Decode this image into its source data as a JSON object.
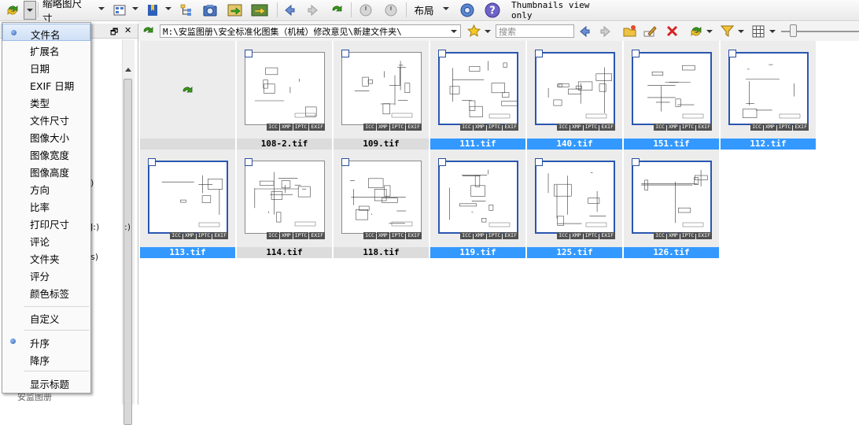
{
  "toolbar": {
    "thumbnail_size_label": "缩略图尺寸",
    "layout_label": "布局",
    "status_text": "Thumbnails view only"
  },
  "pathbar": {
    "path": "M:\\安监图册\\安全标准化图集（机械）修改意见\\新建文件夹\\",
    "search_placeholder": "搜索"
  },
  "sort_menu": {
    "items": [
      "文件名",
      "扩展名",
      "日期",
      "EXIF 日期",
      "类型",
      "文件尺寸",
      "图像大小",
      "图像宽度",
      "图像高度",
      "方向",
      "比率",
      "打印尺寸",
      "评论",
      "文件夹",
      "评分",
      "颜色标签"
    ],
    "custom_label": "自定义",
    "ascending_label": "升序",
    "descending_label": "降序",
    "show_title_label": "显示标题"
  },
  "left_panel": {
    "fragments": [
      ")",
      "J:)",
      "s)",
      ":)"
    ],
    "bottom_folder": "安监图册"
  },
  "badges": [
    "ICC",
    "XMP",
    "IPTC",
    "EXIF"
  ],
  "thumbnails": [
    {
      "name": "",
      "type": "parent-folder",
      "selected": false
    },
    {
      "name": "108-2.tif",
      "selected": false
    },
    {
      "name": "109.tif",
      "selected": false
    },
    {
      "name": "111.tif",
      "selected": true
    },
    {
      "name": "140.tif",
      "selected": true
    },
    {
      "name": "151.tif",
      "selected": true
    },
    {
      "name": "112.tif",
      "selected": true
    },
    {
      "name": "113.tif",
      "selected": true
    },
    {
      "name": "114.tif",
      "selected": false
    },
    {
      "name": "118.tif",
      "selected": false
    },
    {
      "name": "119.tif",
      "selected": true
    },
    {
      "name": "125.tif",
      "selected": true
    },
    {
      "name": "126.tif",
      "selected": true
    }
  ],
  "colors": {
    "selection": "#3399ff",
    "menu_highlight": "#cfe0f6"
  }
}
